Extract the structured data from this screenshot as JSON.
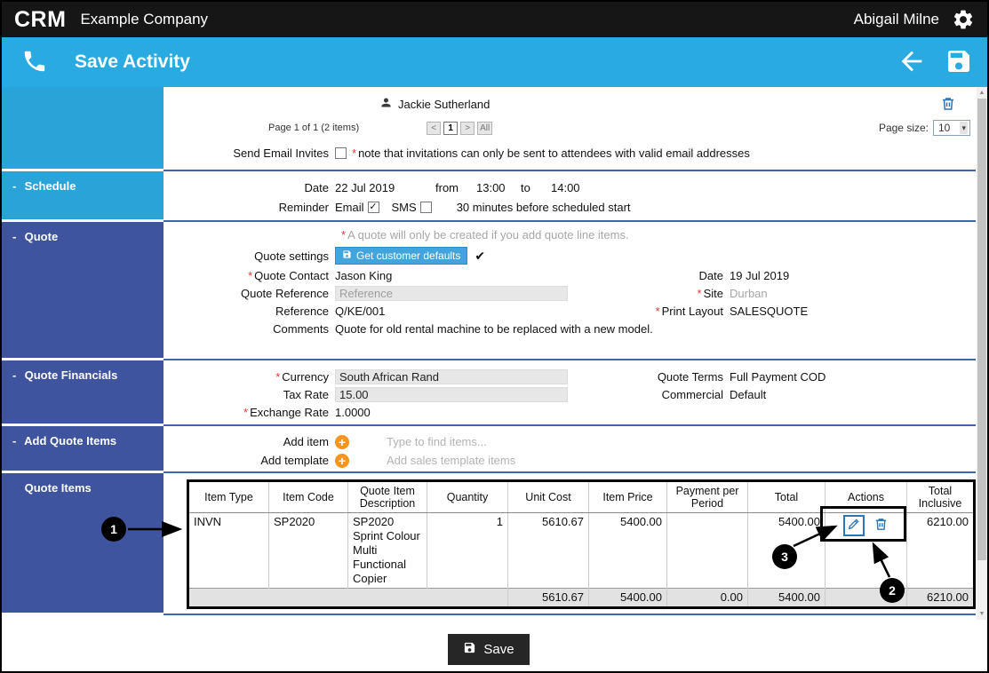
{
  "ui": {
    "collapse_glyph": "-",
    "required_mark": "*",
    "check_glyph": "✓",
    "dropdown_glyph": "▾",
    "scroll_up_glyph": "▲",
    "scroll_down_glyph": "▼"
  },
  "topbar": {
    "brand": "CRM",
    "company": "Example Company",
    "user": "Abigail Milne"
  },
  "activity_bar": {
    "title": "Save Activity"
  },
  "attendees": {
    "name": "Jackie Sutherland",
    "pager_summary": "Page 1 of 1 (2 items)",
    "pager_prev": "<",
    "pager_page": "1",
    "pager_next": ">",
    "pager_all": "All",
    "page_size_label": "Page size:",
    "page_size_value": "10",
    "send_invites_label": "Send Email Invites",
    "note_mark": "*",
    "note_text": "note that invitations can only be sent to attendees with valid email addresses"
  },
  "schedule": {
    "section_label": "Schedule",
    "date_label": "Date",
    "date_value": "22 Jul 2019",
    "from_label": "from",
    "from_value": "13:00",
    "to_label": "to",
    "to_value": "14:00",
    "reminder_label": "Reminder",
    "email_label": "Email",
    "sms_label": "SMS",
    "reminder_text": "30 minutes before scheduled start"
  },
  "quote": {
    "section_label": "Quote",
    "notice_mark": "*",
    "notice_text": "A quote will only be created if you add quote line items.",
    "settings_label": "Quote settings",
    "settings_button_label": "Get customer defaults",
    "settings_check": "✔",
    "contact_label": "Quote Contact",
    "contact_value": "Jason King",
    "date_label": "Date",
    "date_value": "19 Jul 2019",
    "quote_reference_label": "Quote Reference",
    "quote_reference_placeholder": "Reference",
    "site_label": "Site",
    "site_value": "Durban",
    "reference_label": "Reference",
    "reference_value": "Q/KE/001",
    "print_layout_label": "Print Layout",
    "print_layout_value": "SALESQUOTE",
    "comments_label": "Comments",
    "comments_value": "Quote for old rental machine to be replaced with a new model."
  },
  "financials": {
    "section_label": "Quote Financials",
    "currency_label": "Currency",
    "currency_value": "South African Rand",
    "tax_label": "Tax Rate",
    "tax_value": "15.00",
    "exchange_label": "Exchange Rate",
    "exchange_value": "1.0000",
    "terms_label": "Quote Terms",
    "terms_value": "Full Payment COD",
    "commercial_label": "Commercial",
    "commercial_value": "Default"
  },
  "add_items": {
    "section_label": "Add Quote Items",
    "add_item_label": "Add item",
    "add_item_placeholder": "Type to find items...",
    "add_template_label": "Add template",
    "add_template_placeholder": "Add sales template items"
  },
  "quote_items": {
    "section_label": "Quote Items",
    "headers": [
      "Item Type",
      "Item Code",
      "Quote Item Description",
      "Quantity",
      "Unit Cost",
      "Item Price",
      "Payment per Period",
      "Total",
      "Actions",
      "Total Inclusive"
    ],
    "row": {
      "item_type": "INVN",
      "item_code": "SP2020",
      "description": "SP2020 Sprint Colour Multi Functional Copier",
      "quantity": "1",
      "unit_cost": "5610.67",
      "item_price": "5400.00",
      "payment_per_period": "",
      "total": "5400.00",
      "total_inclusive": "6210.00"
    },
    "totals": {
      "unit_cost": "5610.67",
      "item_price": "5400.00",
      "payment_per_period": "0.00",
      "total": "5400.00",
      "total_inclusive": "6210.00"
    }
  },
  "annotations": {
    "callout_1": "1",
    "callout_2": "2",
    "callout_3": "3"
  },
  "footer": {
    "save_label": "Save"
  }
}
